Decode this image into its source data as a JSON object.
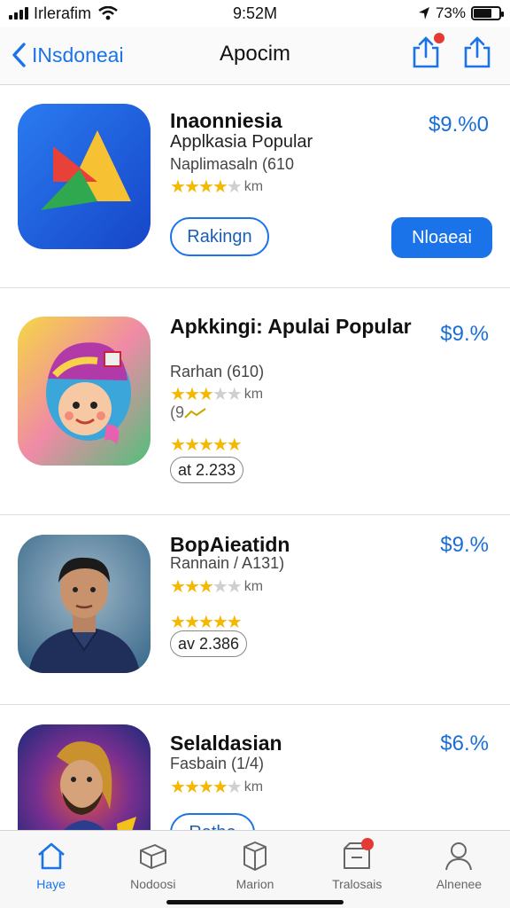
{
  "status_bar": {
    "carrier": "Irlerafim",
    "time": "9:52M",
    "battery_text": "73%",
    "battery_level": 0.73
  },
  "nav": {
    "back_label": "INsdoneai",
    "title": "Apocim"
  },
  "apps": [
    {
      "title": "Inaonniesia",
      "subtitle": "Applkasia Popular",
      "meta": "Naplimasaln (610",
      "rating": 3.5,
      "rating_label": "km",
      "price": "$9.%0",
      "secondary_button": "Rakingn",
      "primary_button": "Nloaeai"
    },
    {
      "title": "Apkkingi: Apulai Popular",
      "meta": "Rarhan (610)",
      "rating": 3,
      "rating_label": "km",
      "trend_label": "(9",
      "rating2": 4.5,
      "count": "at 2.233",
      "price": "$9.%"
    },
    {
      "title": "BopAieatidn",
      "meta": "Rannain / A131)",
      "rating": 3,
      "rating_label": "km",
      "rating2": 5,
      "count": "av 2.386",
      "price": "$9.%"
    },
    {
      "title": "Selaldasian",
      "meta": "Fasbain (1/4)",
      "rating": 3.5,
      "rating_label": "km",
      "partial_button": "Rathe",
      "price": "$6.%"
    }
  ],
  "tabs": [
    {
      "label": "Haye",
      "icon": "home-icon",
      "active": true
    },
    {
      "label": "Nodoosi",
      "icon": "box-icon"
    },
    {
      "label": "Marion",
      "icon": "package-icon"
    },
    {
      "label": "Tralosais",
      "icon": "updates-icon",
      "badge": true
    },
    {
      "label": "Alnenee",
      "icon": "person-icon"
    }
  ],
  "colors": {
    "accent": "#1a73e8",
    "star": "#f5b800",
    "badge": "#e53935"
  }
}
